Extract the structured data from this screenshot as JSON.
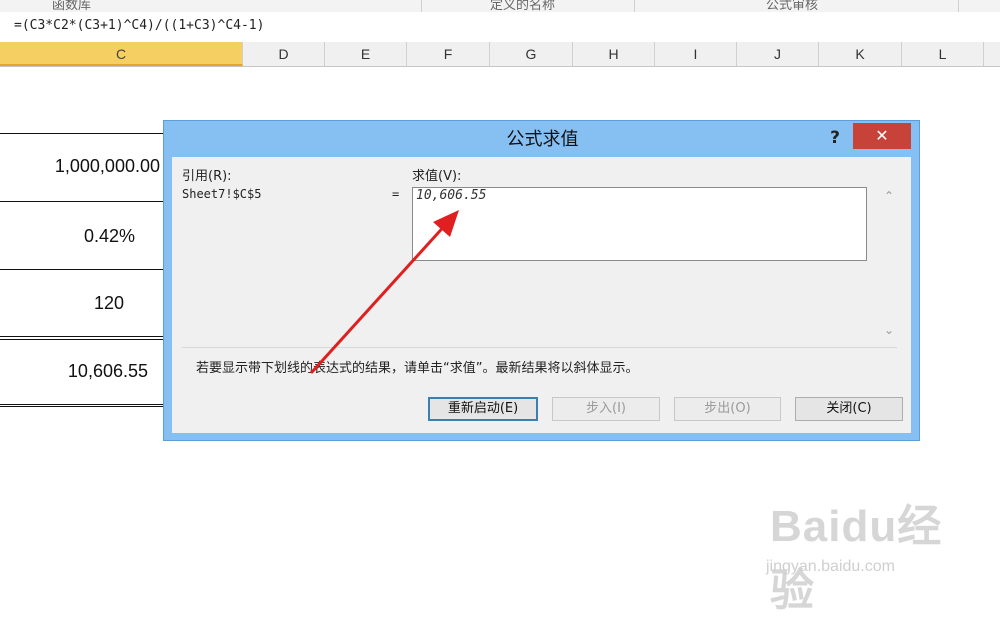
{
  "ribbon": {
    "groups": [
      "函数库",
      "定义的名称",
      "公式审核"
    ]
  },
  "formula_bar": {
    "formula": "=(C3*C2*(C3+1)^C4)/((1+C3)^C4-1)"
  },
  "columns": [
    "C",
    "D",
    "E",
    "F",
    "G",
    "H",
    "I",
    "J",
    "K",
    "L"
  ],
  "active_column": "C",
  "cells": [
    {
      "value": "1,000,000.00"
    },
    {
      "value": "0.42%"
    },
    {
      "value": "120"
    },
    {
      "value": "10,606.55"
    }
  ],
  "dialog": {
    "title": "公式求值",
    "help": "?",
    "close_icon": "✕",
    "reference_label": "引用(R):",
    "reference_value": "Sheet7!$C$5",
    "equals": "=",
    "evaluation_label": "求值(V):",
    "evaluation_value": "10,606.55",
    "hint": "若要显示带下划线的表达式的结果，请单击“求值”。最新结果将以斜体显示。",
    "buttons": {
      "restart": "重新启动(E)",
      "step_in": "步入(I)",
      "step_out": "步出(O)",
      "close": "关闭(C)"
    },
    "icons": {
      "scroll_up": "scroll-up-icon",
      "scroll_down": "scroll-down-icon",
      "close": "close-icon",
      "help": "help-icon"
    }
  },
  "annotation": {
    "color": "#e02020"
  },
  "watermark": {
    "text": "Baidu经验",
    "url": "jingyan.baidu.com"
  },
  "colors": {
    "dialog_frame": "#86bff2",
    "close_button": "#c7433a",
    "active_column": "#f6cf62"
  }
}
